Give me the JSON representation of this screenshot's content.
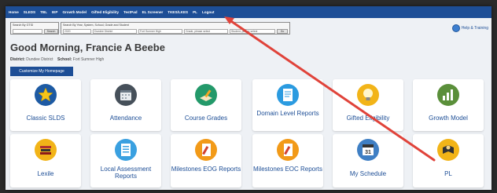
{
  "nav": {
    "items": [
      "Home",
      "SLEDS",
      "TBL",
      "IEP",
      "Growth Model",
      "Gifted Eligibility",
      "TestPad",
      "EL Screener",
      "TKES/LKES",
      "PL",
      "Logout"
    ]
  },
  "search": {
    "gtid_label": "Search By GTID",
    "gtid_button": "Search",
    "filter_label": "Search By Year, System, School, Grade and Student",
    "year": "2020",
    "district": "Dundee District",
    "school": "Fort Sumner High",
    "grade": "Grade, please select",
    "student": "Student, please select",
    "go_label": "Go"
  },
  "help": {
    "label": "Help & Training"
  },
  "greeting": "Good Morning, Francie A Beebe",
  "district_label": "District:",
  "district_value": "Dundee District",
  "school_label": "School:",
  "school_value": "Fort Sumner High",
  "customize_button": "Customize My Homepage",
  "tiles": [
    {
      "label": "Classic SLDS",
      "icon": "star-icon"
    },
    {
      "label": "Attendance",
      "icon": "calendar-icon"
    },
    {
      "label": "Course Grades",
      "icon": "book-pencil-icon"
    },
    {
      "label": "Domain Level Reports",
      "icon": "report-icon"
    },
    {
      "label": "Gifted Eligibility",
      "icon": "lightbulb-icon"
    },
    {
      "label": "Growth Model",
      "icon": "bar-chart-icon"
    },
    {
      "label": "Lexile",
      "icon": "stack-of-books-icon"
    },
    {
      "label": "Local Assessment Reports",
      "icon": "list-icon"
    },
    {
      "label": "Milestones EOG Reports",
      "icon": "test-paper-icon"
    },
    {
      "label": "Milestones EOC Reports",
      "icon": "test-paper-icon"
    },
    {
      "label": "My Schedule",
      "icon": "calendar-31-icon"
    },
    {
      "label": "PL",
      "icon": "reading-icon"
    }
  ],
  "calendar_day": "31",
  "colors": {
    "nav": "#1d4e96",
    "tile_icon_bg": "#1d5aa3",
    "tile_text": "#1d4e96",
    "annotation_arrow": "#e0433a"
  }
}
